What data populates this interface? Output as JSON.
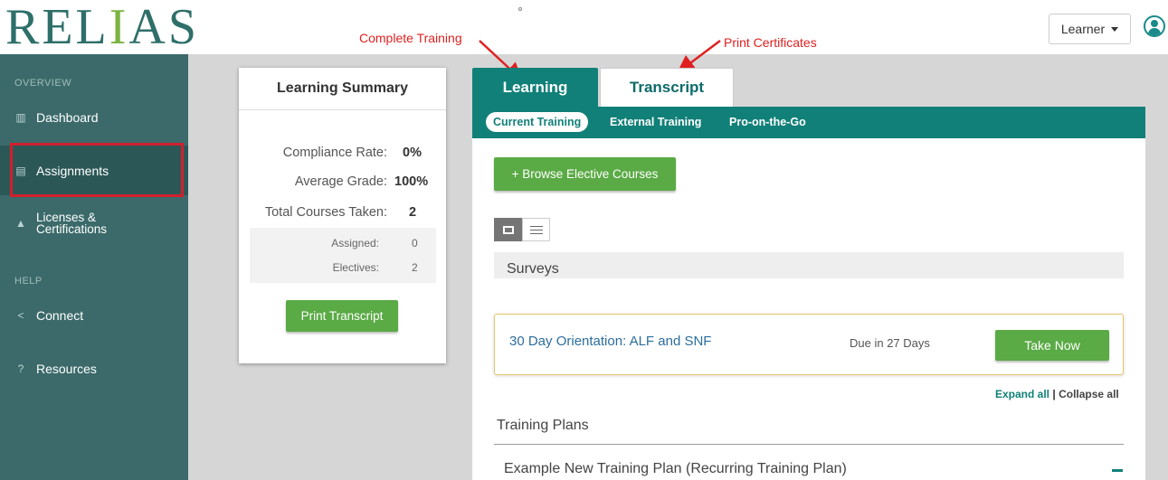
{
  "brand": {
    "logo_text_1": "REL",
    "logo_text_2": "I",
    "logo_text_3": "AS"
  },
  "header": {
    "role_selector": "Learner"
  },
  "annotations": {
    "complete_training": "Complete Training",
    "print_certificates": "Print Certificates",
    "color": "#e02020"
  },
  "sidebar": {
    "overview_label": "OVERVIEW",
    "help_label": "HELP",
    "items": [
      {
        "label": "Dashboard",
        "icon": "bar-chart-icon"
      },
      {
        "label": "Assignments",
        "icon": "assignments-icon"
      },
      {
        "label": "Licenses &\nCertifications",
        "icon": "graduation-cap-icon"
      },
      {
        "label": "Connect",
        "icon": "share-icon"
      },
      {
        "label": "Resources",
        "icon": "question-icon"
      }
    ]
  },
  "summary": {
    "title": "Learning Summary",
    "compliance_label": "Compliance Rate:",
    "compliance_value": "0%",
    "grade_label": "Average Grade:",
    "grade_value": "100%",
    "total_label": "Total Courses Taken:",
    "total_value": "2",
    "assigned_label": "Assigned:",
    "assigned_value": "0",
    "electives_label": "Electives:",
    "electives_value": "2",
    "print_button": "Print Transcript"
  },
  "tabs": {
    "learning": "Learning",
    "transcript": "Transcript"
  },
  "subnav": {
    "current": "Current Training",
    "external": "External Training",
    "pro": "Pro-on-the-Go"
  },
  "main": {
    "browse_button": "+ Browse Elective Courses",
    "surveys_heading": "Surveys",
    "survey": {
      "title": "30 Day Orientation: ALF and SNF",
      "due": "Due in 27 Days",
      "action": "Take Now"
    },
    "expand_all": "Expand all",
    "separator": "|",
    "collapse_all": "Collapse all",
    "plans_heading": "Training Plans",
    "plan_item": "Example New Training Plan (Recurring Training Plan)"
  },
  "colors": {
    "teal": "#118078",
    "sidebar": "#3c6a6a",
    "green": "#5aaa45",
    "highlight": "#d21f2c"
  }
}
